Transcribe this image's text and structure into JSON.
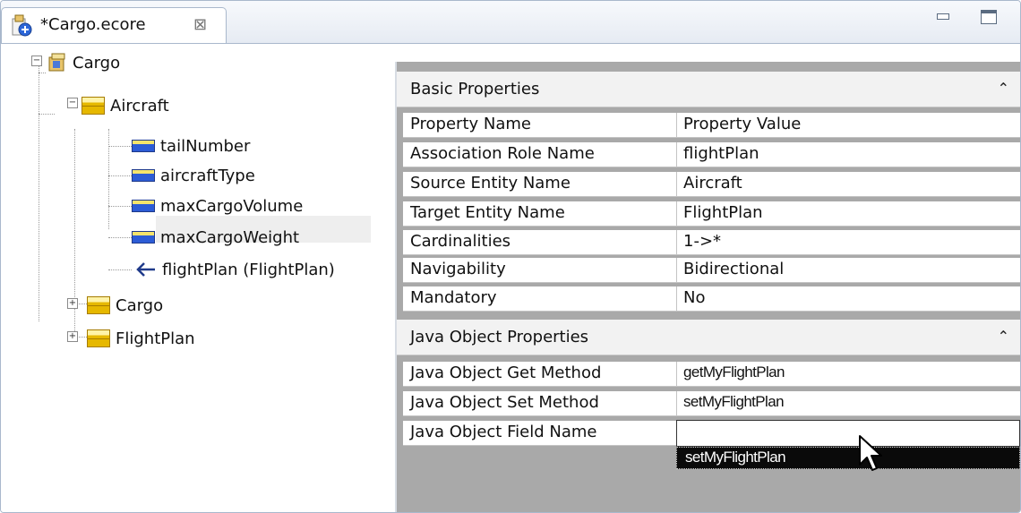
{
  "tab": {
    "title": "*Cargo.ecore",
    "close_glyph": "⊠",
    "icon": "ecore-file-icon"
  },
  "window_controls": {
    "minimize": "minimize-icon",
    "maximize": "maximize-icon"
  },
  "tree": {
    "root": {
      "label": "Cargo",
      "icon": "package-icon",
      "expanded": true
    },
    "items": [
      {
        "label": "Aircraft",
        "icon": "class-icon",
        "expanded": true
      },
      {
        "label": "tailNumber",
        "icon": "attribute-icon"
      },
      {
        "label": "aircraftType",
        "icon": "attribute-icon"
      },
      {
        "label": "maxCargoVolume",
        "icon": "attribute-icon"
      },
      {
        "label": "maxCargoWeight",
        "icon": "attribute-icon"
      },
      {
        "label": "flightPlan (FlightPlan)",
        "icon": "reference-icon",
        "selected": true
      },
      {
        "label": "Cargo",
        "icon": "class-icon",
        "expanded": false
      },
      {
        "label": "FlightPlan",
        "icon": "class-icon",
        "expanded": false
      }
    ]
  },
  "basic_properties": {
    "title": "Basic Properties",
    "collapse_glyph": "⌃",
    "header": {
      "name": "Property Name",
      "value": "Property Value"
    },
    "rows": [
      {
        "name": "Association Role Name",
        "value": "flightPlan"
      },
      {
        "name": "Source Entity Name",
        "value": "Aircraft"
      },
      {
        "name": "Target Entity Name",
        "value": "FlightPlan"
      },
      {
        "name": "Cardinalities",
        "value": "1->*"
      },
      {
        "name": "Navigability",
        "value": "Bidirectional"
      },
      {
        "name": "Mandatory",
        "value": "No"
      }
    ]
  },
  "java_properties": {
    "title": "Java Object Properties",
    "collapse_glyph": "⌃",
    "rows": [
      {
        "name": "Java Object Get Method",
        "value": "getMyFlightPlan"
      },
      {
        "name": "Java Object Set Method",
        "value": "setMyFlightPlan"
      },
      {
        "name": "Java Object Field Name",
        "value": ""
      }
    ],
    "suggestion": "setMyFlightPlan"
  },
  "colors": {
    "selection": "#eeeeee",
    "dropdown_bg": "#0a0a0a",
    "panel_gray": "#a9a9a9"
  }
}
